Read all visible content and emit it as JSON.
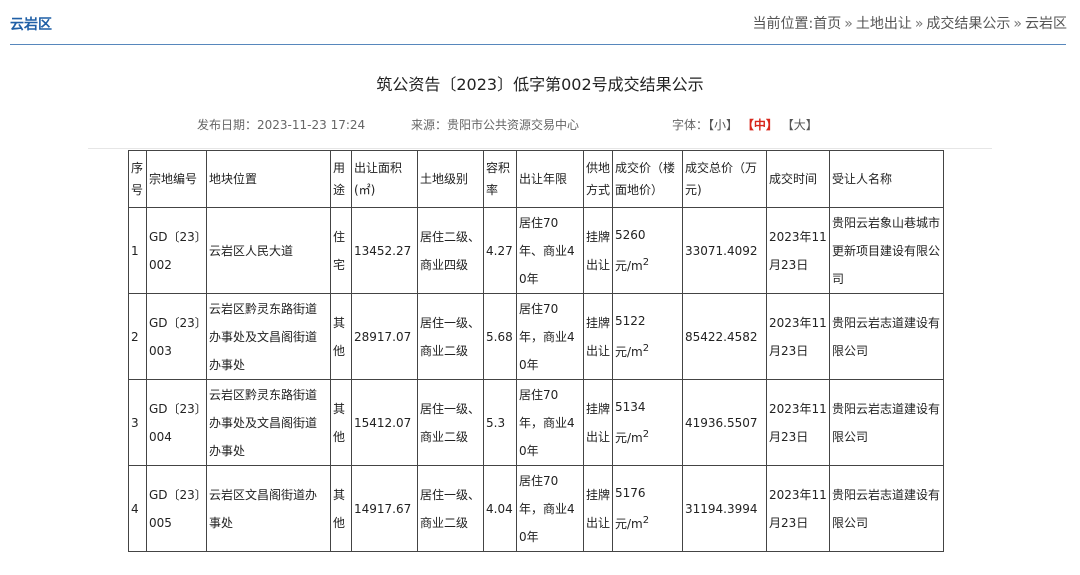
{
  "header": {
    "section_title": "云岩区",
    "breadcrumb": {
      "prefix": "当前位置:",
      "items": [
        "首页",
        "土地出让",
        "成交结果公示",
        "云岩区"
      ],
      "separator": "»"
    }
  },
  "notice": {
    "title": "筑公资告〔2023〕低字第002号成交结果公示",
    "publish_date_label": "发布日期：",
    "publish_date": "2023-11-23 17:24",
    "source_label": "来源：",
    "source": "贵阳市公共资源交易中心",
    "font_size_label": "字体：",
    "font_small": "【小】",
    "font_medium": "【中】",
    "font_large": "【大】"
  },
  "table": {
    "headers": [
      "序号",
      "宗地编号",
      "地块位置",
      "用途",
      "出让面积(㎡)",
      "土地级别",
      "容积率",
      "出让年限",
      "供地方式",
      "成交价（楼面地价）",
      "成交总价（万元)",
      "成交时间",
      "受让人名称"
    ],
    "rows": [
      {
        "no": "1",
        "code": "GD〔23〕002",
        "location": "云岩区人民大道",
        "use": "住宅",
        "area": "13452.27",
        "level": "居住二级、商业四级",
        "far": "4.27",
        "term": "居住70年、商业40年",
        "method": "挂牌出让",
        "price": "5260",
        "price_unit": "元/m",
        "price_unit_sup": "2",
        "total": "33071.4092",
        "date": "2023年11月23日",
        "assignee": "贵阳云岩象山巷城市更新项目建设有限公司"
      },
      {
        "no": "2",
        "code": "GD〔23〕003",
        "location": "云岩区黔灵东路街道办事处及文昌阁街道办事处",
        "use": "其他",
        "area": "28917.07",
        "level": "居住一级、商业二级",
        "far": "5.68",
        "term": "居住70年，商业40年",
        "method": "挂牌出让",
        "price": "5122",
        "price_unit": "元/m",
        "price_unit_sup": "2",
        "total": "85422.4582",
        "date": "2023年11月23日",
        "assignee": "贵阳云岩志道建设有限公司"
      },
      {
        "no": "3",
        "code": "GD〔23〕004",
        "location": "云岩区黔灵东路街道办事处及文昌阁街道办事处",
        "use": "其他",
        "area": "15412.07",
        "level": "居住一级、商业二级",
        "far": "5.3",
        "term": "居住70年，商业40年",
        "method": "挂牌出让",
        "price": "5134",
        "price_unit": "元/m",
        "price_unit_sup": "2",
        "total": "41936.5507",
        "date": "2023年11月23日",
        "assignee": "贵阳云岩志道建设有限公司"
      },
      {
        "no": "4",
        "code": "GD〔23〕005",
        "location": "云岩区文昌阁街道办事处",
        "use": "其他",
        "area": "14917.67",
        "level": "居住一级、商业二级",
        "far": "4.04",
        "term": "居住70年，商业40年",
        "method": "挂牌出让",
        "price": "5176",
        "price_unit": "元/m",
        "price_unit_sup": "2",
        "total": "31194.3994",
        "date": "2023年11月23日",
        "assignee": "贵阳云岩志道建设有限公司"
      }
    ]
  }
}
